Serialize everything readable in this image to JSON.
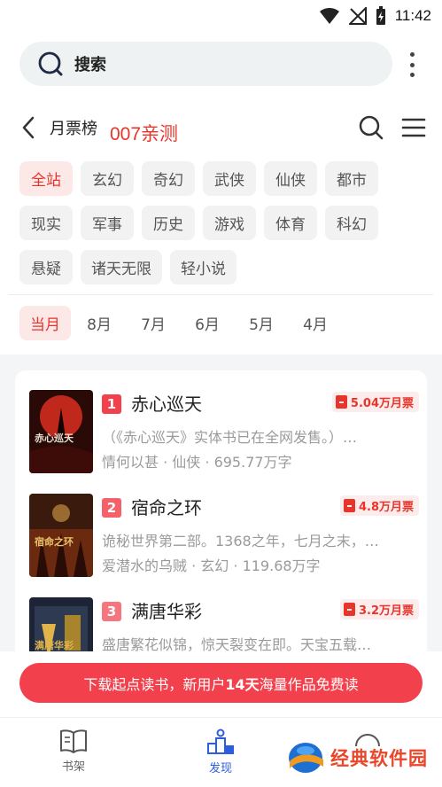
{
  "status": {
    "time": "11:42"
  },
  "search": {
    "label": "搜索"
  },
  "header": {
    "title": "月票榜",
    "note": "007亲测"
  },
  "genres": [
    {
      "label": "全站",
      "active": true
    },
    {
      "label": "玄幻"
    },
    {
      "label": "奇幻"
    },
    {
      "label": "武侠"
    },
    {
      "label": "仙侠"
    },
    {
      "label": "都市"
    },
    {
      "label": "现实"
    },
    {
      "label": "军事"
    },
    {
      "label": "历史"
    },
    {
      "label": "游戏"
    },
    {
      "label": "体育"
    },
    {
      "label": "科幻"
    },
    {
      "label": "悬疑"
    },
    {
      "label": "诸天无限"
    },
    {
      "label": "轻小说"
    }
  ],
  "months": [
    {
      "label": "当月",
      "active": true
    },
    {
      "label": "8月"
    },
    {
      "label": "7月"
    },
    {
      "label": "6月"
    },
    {
      "label": "5月"
    },
    {
      "label": "4月"
    }
  ],
  "books": [
    {
      "rank": "1",
      "title": "赤心巡天",
      "votes": "5.04万月票",
      "desc": "（《赤心巡天》实体书已在全网发售。）…",
      "author": "情何以甚",
      "genre": "仙侠",
      "words": "695.77万字",
      "cover_text": "赤心巡天",
      "rank_color": "#f2404c"
    },
    {
      "rank": "2",
      "title": "宿命之环",
      "votes": "4.8万月票",
      "desc": "诡秘世界第二部。1368之年，七月之末，…",
      "author": "爱潜水的乌贼",
      "genre": "玄幻",
      "words": "119.68万字",
      "cover_text": "宿命之环",
      "rank_color": "#f5616b"
    },
    {
      "rank": "3",
      "title": "满唐华彩",
      "votes": "3.2万月票",
      "desc": "盛唐繁花似锦，惊天裂变在即。天宝五载…",
      "author": "",
      "genre": "",
      "words": "",
      "cover_text": "满唐华彩",
      "rank_color": "#f5767e"
    }
  ],
  "banner": {
    "prefix": "下载起点读书，新用户",
    "highlight": "14天",
    "suffix": "海量作品免费读"
  },
  "nav": {
    "shelf": "书架",
    "discover": "发现"
  },
  "watermark": {
    "text": "经典软件园"
  },
  "colors": {
    "accent": "#e8352b",
    "active_nav": "#2e5ee0",
    "banner": "#f2404c"
  }
}
